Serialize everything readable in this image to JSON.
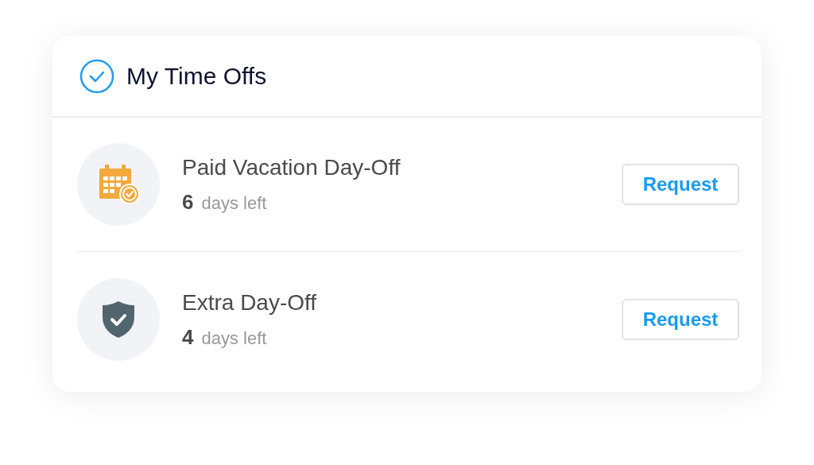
{
  "card": {
    "title": "My Time Offs"
  },
  "items": [
    {
      "kind": "calendar",
      "name": "Paid Vacation Day-Off",
      "count": "6",
      "unit": "days left",
      "button": "Request"
    },
    {
      "kind": "shield",
      "name": "Extra Day-Off",
      "count": "4",
      "unit": "days left",
      "button": "Request"
    }
  ]
}
